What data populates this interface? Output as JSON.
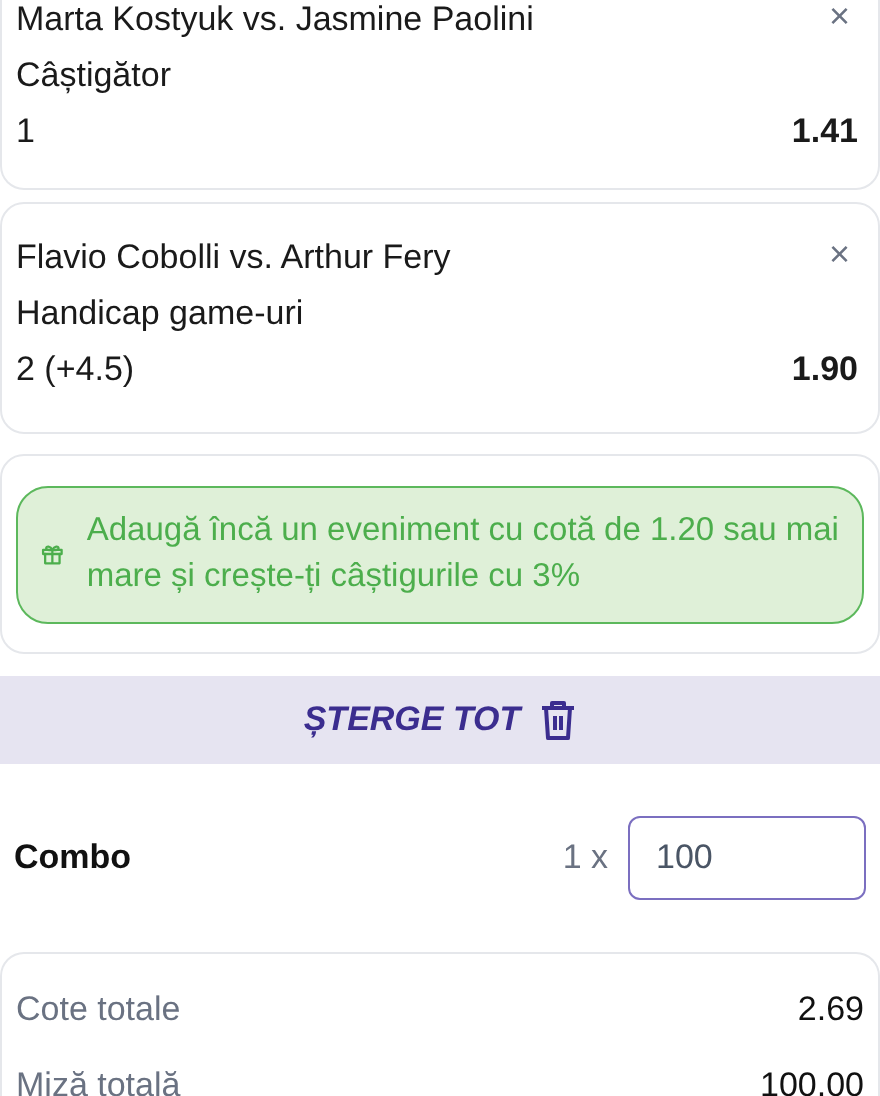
{
  "selections": [
    {
      "match": "Marta Kostyuk vs. Jasmine Paolini",
      "market": "Câștigător",
      "pick": "1",
      "odds": "1.41",
      "close": "×"
    },
    {
      "match": "Flavio Cobolli vs. Arthur Fery",
      "market": "Handicap game-uri",
      "pick": "2 (+4.5)",
      "odds": "1.90",
      "close": "×"
    }
  ],
  "promo": {
    "text": "Adaugă încă un eveniment cu cotă de 1.20 sau mai mare și crește-ți câștigurile cu 3%"
  },
  "clear_all": {
    "label": "ȘTERGE TOT"
  },
  "combo": {
    "label": "Combo",
    "multiplier": "1 x",
    "stake": "100"
  },
  "totals": [
    {
      "label": "Cote totale",
      "value": "2.69"
    },
    {
      "label": "Miză totală",
      "value": "100.00"
    }
  ]
}
